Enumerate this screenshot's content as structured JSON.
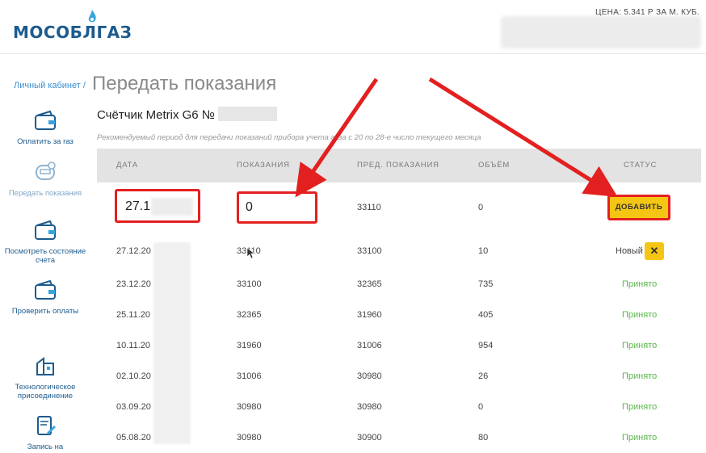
{
  "header": {
    "logo_text": "МОСОБЛГАЗ",
    "price": "ЦЕНА: 5.341 Р ЗА М. КУБ."
  },
  "breadcrumb": "Личный кабинет /",
  "page_title": "Передать показания",
  "sidebar": {
    "items": [
      {
        "label": "Оплатить за газ",
        "icon": "wallet-icon"
      },
      {
        "label": "Передать показания",
        "icon": "meter-icon"
      },
      {
        "label": "Посмотреть состояние счета",
        "icon": "wallet-icon"
      },
      {
        "label": "Проверить оплаты",
        "icon": "wallet-icon"
      },
      {
        "label": "Технологическое присоединение",
        "icon": "building-icon"
      },
      {
        "label": "Запись на",
        "icon": "document-edit-icon"
      }
    ]
  },
  "meter": {
    "title": "Счётчик Metrix G6 №",
    "note": "Рекомендуемый период для передачи показаний прибора учета газа с 20 по 28-е число текущего месяца"
  },
  "table": {
    "headers": [
      "ДАТА",
      "ПОКАЗАНИЯ",
      "ПРЕД. ПОКАЗАНИЯ",
      "ОБЪЁМ",
      "СТАТУС"
    ],
    "input_row": {
      "date": "27.1",
      "reading": "0",
      "prev": "33110",
      "volume": "0",
      "button": "ДОБАВИТЬ"
    },
    "rows": [
      {
        "date": "27.12.20",
        "reading": "33110",
        "prev": "33100",
        "volume": "10",
        "status": "Новый"
      },
      {
        "date": "23.12.20",
        "reading": "33100",
        "prev": "32365",
        "volume": "735",
        "status": "Принято"
      },
      {
        "date": "25.11.20",
        "reading": "32365",
        "prev": "31960",
        "volume": "405",
        "status": "Принято"
      },
      {
        "date": "10.11.20",
        "reading": "31960",
        "prev": "31006",
        "volume": "954",
        "status": "Принято"
      },
      {
        "date": "02.10.20",
        "reading": "31006",
        "prev": "30980",
        "volume": "26",
        "status": "Принято"
      },
      {
        "date": "03.09.20",
        "reading": "30980",
        "prev": "30980",
        "volume": "0",
        "status": "Принято"
      },
      {
        "date": "05.08.20",
        "reading": "30980",
        "prev": "30900",
        "volume": "80",
        "status": "Принято"
      }
    ],
    "delete_symbol": "✕"
  },
  "colors": {
    "brand": "#1d5b8e",
    "accept": "#57b847",
    "button": "#f4c613",
    "highlight": "#e32020"
  }
}
